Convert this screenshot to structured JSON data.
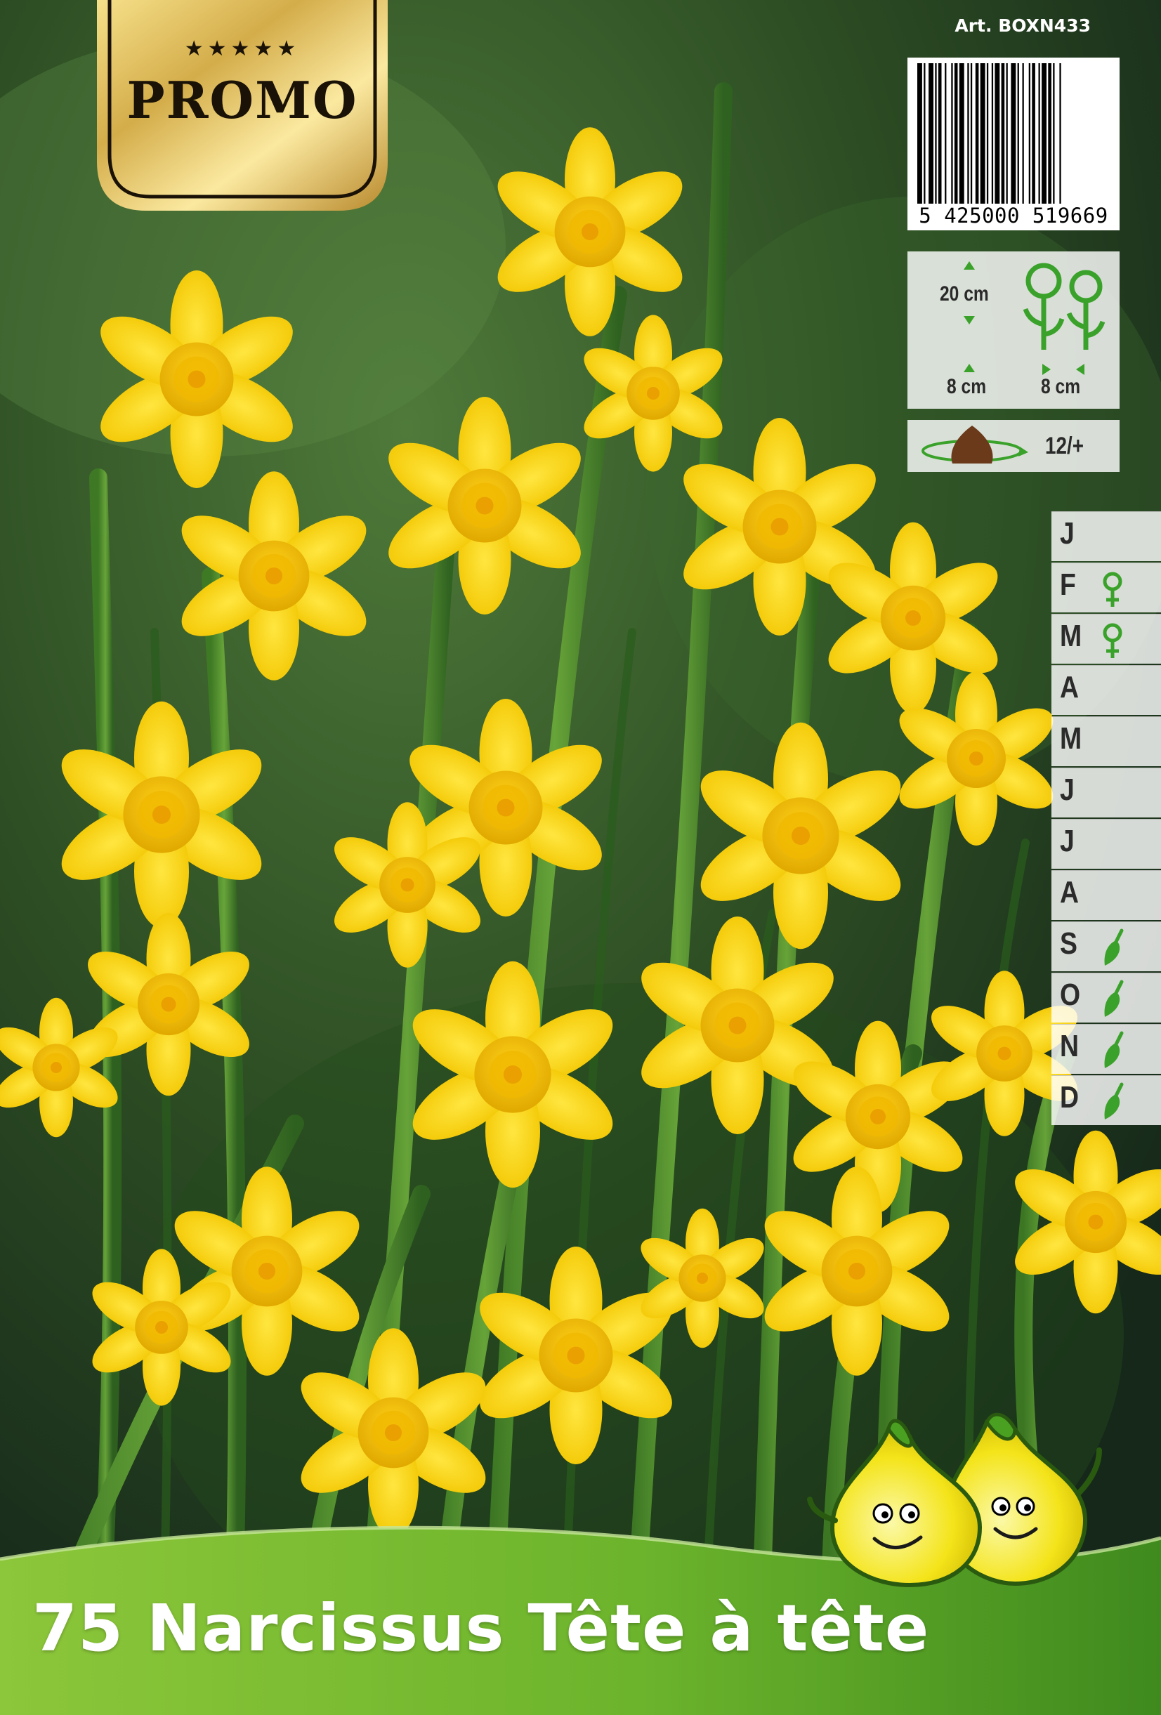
{
  "promo": {
    "stars": "★★★★★",
    "label": "PROMO"
  },
  "article": "Art. BOXN433",
  "barcode": {
    "number": "5 425000 519669"
  },
  "dimensions": {
    "height": "20 cm",
    "depth": "8 cm",
    "spacing": "8 cm",
    "bulb_size": "12/+"
  },
  "calendar": {
    "months": [
      {
        "letter": "J",
        "icon": ""
      },
      {
        "letter": "F",
        "icon": "flower-icon"
      },
      {
        "letter": "M",
        "icon": "flower-icon"
      },
      {
        "letter": "A",
        "icon": ""
      },
      {
        "letter": "M",
        "icon": ""
      },
      {
        "letter": "J",
        "icon": ""
      },
      {
        "letter": "J",
        "icon": ""
      },
      {
        "letter": "A",
        "icon": ""
      },
      {
        "letter": "S",
        "icon": "trowel-icon"
      },
      {
        "letter": "O",
        "icon": "trowel-icon"
      },
      {
        "letter": "N",
        "icon": "trowel-icon"
      },
      {
        "letter": "D",
        "icon": "trowel-icon"
      }
    ]
  },
  "title": "75 Narcissus Tête à tête",
  "colors": {
    "flower": "#f7d000",
    "leaf": "#4a8a2a",
    "band": "#6cb42c",
    "gold": "#c9a23a"
  }
}
